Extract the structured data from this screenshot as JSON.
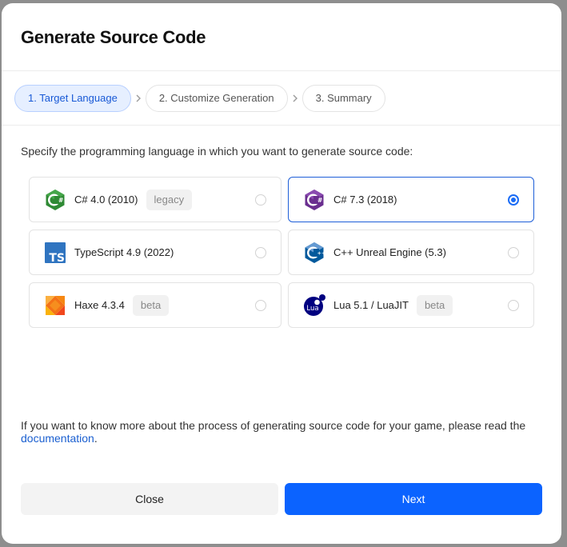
{
  "dialog": {
    "title": "Generate Source Code"
  },
  "steps": [
    {
      "label": "1. Target Language",
      "active": true
    },
    {
      "label": "2. Customize Generation",
      "active": false
    },
    {
      "label": "3. Summary",
      "active": false
    }
  ],
  "intro": "Specify the programming language in which you want to generate source code:",
  "languages": [
    {
      "name": "C# 4.0 (2010)",
      "badge": "legacy",
      "icon": "csharp-green-icon",
      "selected": false
    },
    {
      "name": "C# 7.3 (2018)",
      "badge": "",
      "icon": "csharp-purple-icon",
      "selected": true
    },
    {
      "name": "TypeScript 4.9 (2022)",
      "badge": "",
      "icon": "typescript-icon",
      "selected": false
    },
    {
      "name": "C++ Unreal Engine (5.3)",
      "badge": "",
      "icon": "cpp-icon",
      "selected": false
    },
    {
      "name": "Haxe 4.3.4",
      "badge": "beta",
      "icon": "haxe-icon",
      "selected": false
    },
    {
      "name": "Lua 5.1 / LuaJIT",
      "badge": "beta",
      "icon": "lua-icon",
      "selected": false
    }
  ],
  "icon_text": {
    "typescript": "TS",
    "lua": "Lua"
  },
  "footnote": {
    "text": "If you want to know more about the process of generating source code for your game, please read the ",
    "link": "documentation",
    "end": "."
  },
  "buttons": {
    "close": "Close",
    "next": "Next"
  },
  "colors": {
    "primary": "#0b63ff",
    "selected_border": "#1e5fd8",
    "active_step_bg": "#e6efff"
  }
}
